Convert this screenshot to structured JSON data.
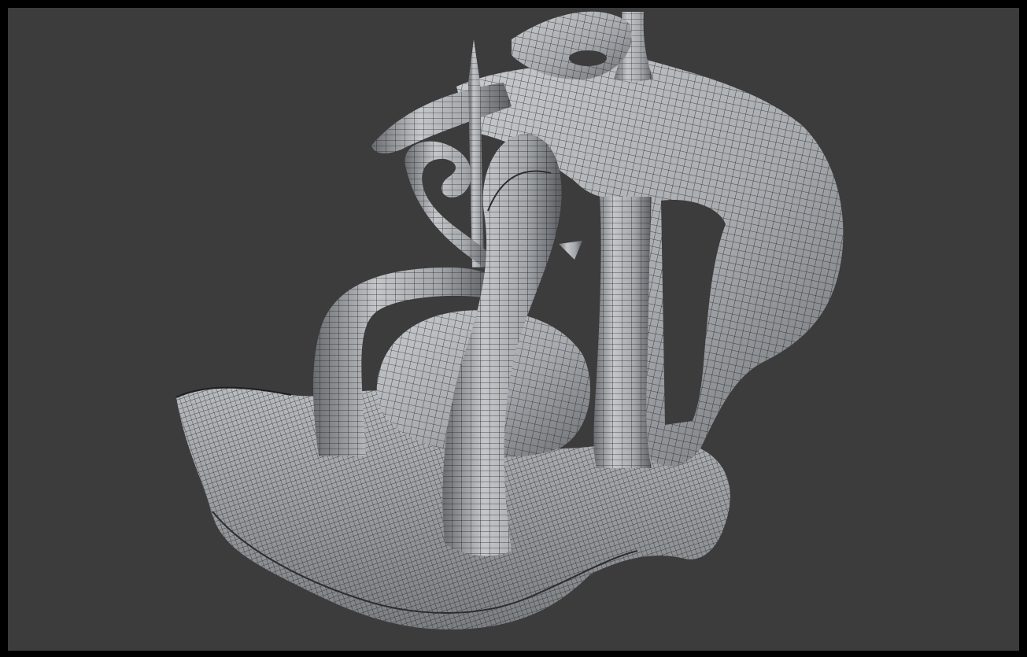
{
  "viewport": {
    "background_color": "#3c3c3c",
    "border_color": "#000000",
    "mesh_fill_light": "#bfc1c4",
    "mesh_fill_mid": "#9a9da1",
    "mesh_fill_dark": "#5f6266",
    "wire_color": "#1a1a1a",
    "render_mode": "shaded-wireframe",
    "model_icon": "sculpted-tentacle-mesh-icon"
  }
}
